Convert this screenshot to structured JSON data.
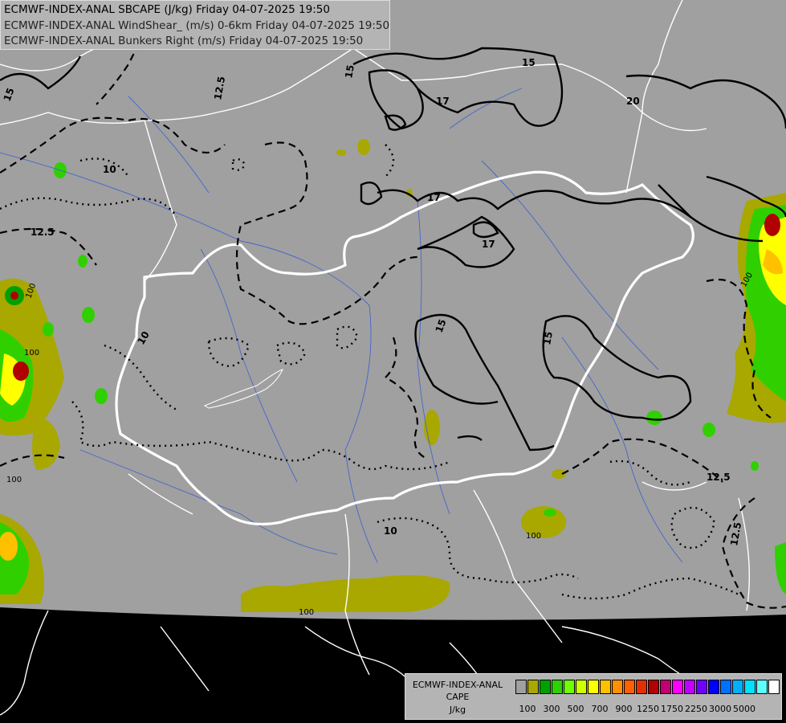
{
  "header": {
    "lines": [
      "ECMWF-INDEX-ANAL SBCAPE (J/kg) Friday 04-07-2025 19:50",
      "ECMWF-INDEX-ANAL WindShear_ (m/s) 0-6km Friday 04-07-2025 19:50",
      "ECMWF-INDEX-ANAL Bunkers Right (m/s) Friday 04-07-2025 19:50"
    ]
  },
  "legend": {
    "title_lines": [
      "ECMWF-INDEX-ANAL",
      "CAPE",
      "J/kg"
    ],
    "colors": [
      "#a0a0a0",
      "#a8a800",
      "#00a000",
      "#30d000",
      "#70ff00",
      "#d0ff00",
      "#ffff00",
      "#ffc000",
      "#ff9000",
      "#ff6000",
      "#e03000",
      "#b00000",
      "#c00070",
      "#ff00ff",
      "#c000ff",
      "#7000ff",
      "#0000ff",
      "#0070ff",
      "#00b0ff",
      "#00e0ff",
      "#60ffff",
      "#ffffff"
    ],
    "ticks": [
      "100",
      "300",
      "500",
      "700",
      "900",
      "1250",
      "1750",
      "2250",
      "3000",
      "5000"
    ]
  },
  "contour_labels": {
    "shear": [
      "15",
      "12.5",
      "15",
      "17",
      "15",
      "20",
      "17",
      "17",
      "12.5",
      "10",
      "15",
      "15",
      "12.5",
      "12.5",
      "10",
      "10"
    ],
    "cape": [
      "100",
      "100",
      "100",
      "100",
      "100",
      "100"
    ]
  }
}
